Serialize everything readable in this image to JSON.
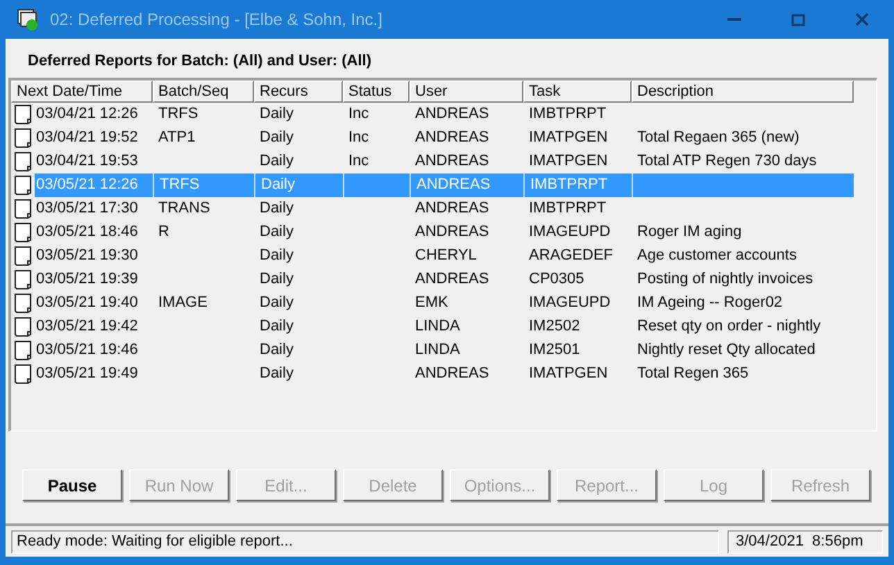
{
  "window": {
    "title": "02: Deferred Processing - [Elbe & Sohn, Inc.]"
  },
  "heading": "Deferred Reports for Batch:  (All) and User: (All)",
  "table": {
    "columns": [
      "Next Date/Time",
      "Batch/Seq",
      "Recurs",
      "Status",
      "User",
      "Task",
      "Description"
    ],
    "rows": [
      {
        "selected": false,
        "cells": [
          "03/04/21 12:26",
          "TRFS",
          "Daily",
          "Inc",
          "ANDREAS",
          "IMBTPRPT",
          null
        ]
      },
      {
        "selected": false,
        "cells": [
          "03/04/21 19:52",
          "ATP1",
          "Daily",
          "Inc",
          "ANDREAS",
          "IMATPGEN",
          "Total Regaen 365 (new)"
        ]
      },
      {
        "selected": false,
        "cells": [
          "03/04/21 19:53",
          null,
          "Daily",
          "Inc",
          "ANDREAS",
          "IMATPGEN",
          "Total ATP Regen 730 days"
        ]
      },
      {
        "selected": true,
        "cells": [
          "03/05/21 12:26",
          "TRFS",
          "Daily",
          null,
          "ANDREAS",
          "IMBTPRPT",
          null
        ]
      },
      {
        "selected": false,
        "cells": [
          "03/05/21 17:30",
          "TRANS",
          "Daily",
          null,
          "ANDREAS",
          "IMBTPRPT",
          null
        ]
      },
      {
        "selected": false,
        "cells": [
          "03/05/21 18:46",
          "R",
          "Daily",
          null,
          "ANDREAS",
          "IMAGEUPD",
          "Roger IM aging"
        ]
      },
      {
        "selected": false,
        "cells": [
          "03/05/21 19:30",
          null,
          "Daily",
          null,
          "CHERYL",
          "ARAGEDEF",
          "Age customer accounts"
        ]
      },
      {
        "selected": false,
        "cells": [
          "03/05/21 19:39",
          null,
          "Daily",
          null,
          "ANDREAS",
          "CP0305",
          "Posting of nightly invoices"
        ]
      },
      {
        "selected": false,
        "cells": [
          "03/05/21 19:40",
          "IMAGE",
          "Daily",
          null,
          "EMK",
          "IMAGEUPD",
          "IM Ageing -- Roger02"
        ]
      },
      {
        "selected": false,
        "cells": [
          "03/05/21 19:42",
          null,
          "Daily",
          null,
          "LINDA",
          "IM2502",
          "Reset qty on order - nightly"
        ]
      },
      {
        "selected": false,
        "cells": [
          "03/05/21 19:46",
          null,
          "Daily",
          null,
          "LINDA",
          "IM2501",
          "Nightly reset Qty allocated"
        ]
      },
      {
        "selected": false,
        "cells": [
          "03/05/21 19:49",
          null,
          "Daily",
          null,
          "ANDREAS",
          "IMATPGEN",
          "Total Regen 365"
        ]
      }
    ]
  },
  "buttons": [
    {
      "label": "Pause",
      "disabled": false
    },
    {
      "label": "Run Now",
      "disabled": true
    },
    {
      "label": "Edit...",
      "disabled": true
    },
    {
      "label": "Delete",
      "disabled": true
    },
    {
      "label": "Options...",
      "disabled": true
    },
    {
      "label": "Report...",
      "disabled": true
    },
    {
      "label": "Log",
      "disabled": true
    },
    {
      "label": "Refresh",
      "disabled": true
    }
  ],
  "status_bar": {
    "message": "Ready mode: Waiting for eligible report...",
    "datetime": "3/04/2021  8:56pm"
  }
}
